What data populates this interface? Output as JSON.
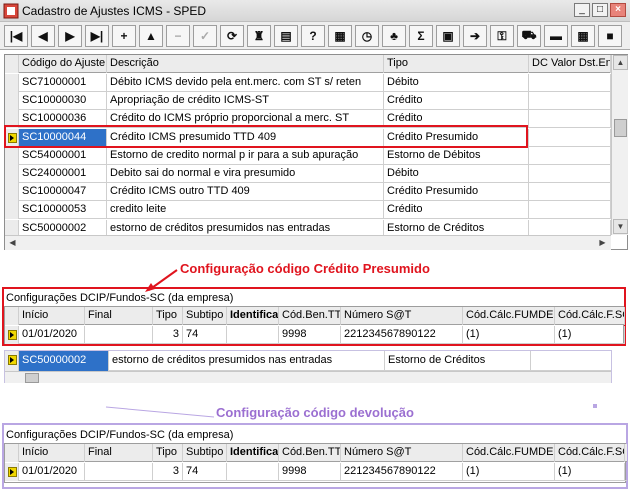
{
  "window": {
    "title": "Cadastro de Ajustes ICMS - SPED"
  },
  "toolbar": {
    "buttons": [
      {
        "name": "first-record-icon",
        "glyph": "|◀"
      },
      {
        "name": "prev-record-icon",
        "glyph": "◀"
      },
      {
        "name": "next-record-icon",
        "glyph": "▶"
      },
      {
        "name": "last-record-icon",
        "glyph": "▶|"
      },
      {
        "name": "add-record-icon",
        "glyph": "+"
      },
      {
        "name": "edit-up-icon",
        "glyph": "▲"
      },
      {
        "name": "delete-record-icon",
        "glyph": "−"
      },
      {
        "name": "confirm-icon",
        "glyph": "✓"
      },
      {
        "name": "refresh-icon",
        "glyph": "⟳"
      },
      {
        "name": "stamp-icon",
        "glyph": "♜"
      },
      {
        "name": "folder-icon",
        "glyph": "▤"
      },
      {
        "name": "help-search-icon",
        "glyph": "?"
      },
      {
        "name": "calculator-icon",
        "glyph": "▦"
      },
      {
        "name": "clock-icon",
        "glyph": "◷"
      },
      {
        "name": "tree-icon",
        "glyph": "♣"
      },
      {
        "name": "sum-icon",
        "glyph": "Σ"
      },
      {
        "name": "copy-icon",
        "glyph": "▣"
      },
      {
        "name": "export-icon",
        "glyph": "➔"
      },
      {
        "name": "key-icon",
        "glyph": "⚿"
      },
      {
        "name": "truck-icon",
        "glyph": "⛟"
      },
      {
        "name": "car-icon",
        "glyph": "▬"
      },
      {
        "name": "table-icon",
        "glyph": "▦"
      },
      {
        "name": "stop-icon",
        "glyph": "■"
      }
    ]
  },
  "top_grid": {
    "columns": [
      "Código do Ajuste",
      "Descrição",
      "Tipo",
      "DC Valor Dst.Ent."
    ],
    "rows": [
      {
        "code": "SC71000001",
        "desc": "Débito ICMS devido pela ent.merc. com ST s/ reten",
        "tipo": "Débito"
      },
      {
        "code": "SC10000030",
        "desc": "Apropriação de crédito ICMS-ST",
        "tipo": "Crédito"
      },
      {
        "code": "SC10000036",
        "desc": "Crédito do ICMS próprio proporcional a merc. ST",
        "tipo": "Crédito"
      },
      {
        "code": "SC10000044",
        "desc": "Crédito ICMS presumido TTD 409",
        "tipo": "Crédito Presumido"
      },
      {
        "code": "SC54000001",
        "desc": "Estorno de credito normal p ir para a sub apuração",
        "tipo": "Estorno de Débitos"
      },
      {
        "code": "SC24000001",
        "desc": "Debito sai do normal e vira presumido",
        "tipo": "Débito"
      },
      {
        "code": "SC10000047",
        "desc": "Crédito ICMS outro TTD 409",
        "tipo": "Crédito Presumido"
      },
      {
        "code": "SC10000053",
        "desc": "credito leite",
        "tipo": "Crédito"
      },
      {
        "code": "SC50000002",
        "desc": "estorno de créditos presumidos nas entradas",
        "tipo": "Estorno de Créditos"
      }
    ]
  },
  "annotations": {
    "red_caption": "Configuração código Crédito Presumido",
    "purple_caption": "Configuração código devolução"
  },
  "config1": {
    "title": "Configurações DCIP/Fundos-SC (da empresa)",
    "columns": [
      "Início",
      "Final",
      "Tipo",
      "Subtipo",
      "Identificador",
      "Cód.Ben.TTD",
      "Número S@T",
      "Cód.Cálc.FUMDES",
      "Cód.Cálc.F.SOC"
    ],
    "row": {
      "inicio": "01/01/2020",
      "final": "",
      "tipo": "3",
      "subtipo": "74",
      "identificador": "",
      "ben": "9998",
      "sat": "221234567890122",
      "fumdes": "(1)",
      "fsoc": "(1)"
    }
  },
  "mid_row": {
    "code": "SC50000002",
    "desc": "estorno de créditos presumidos nas entradas",
    "tipo": "Estorno de Créditos"
  },
  "config2": {
    "title": "Configurações DCIP/Fundos-SC (da empresa)",
    "columns": [
      "Início",
      "Final",
      "Tipo",
      "Subtipo",
      "Identificador",
      "Cód.Ben.TTD",
      "Número S@T",
      "Cód.Cálc.FUMDES",
      "Cód.Cálc.F.SOC"
    ],
    "row": {
      "inicio": "01/01/2020",
      "final": "",
      "tipo": "3",
      "subtipo": "74",
      "identificador": "",
      "ben": "9998",
      "sat": "221234567890122",
      "fumdes": "(1)",
      "fsoc": "(1)"
    }
  }
}
